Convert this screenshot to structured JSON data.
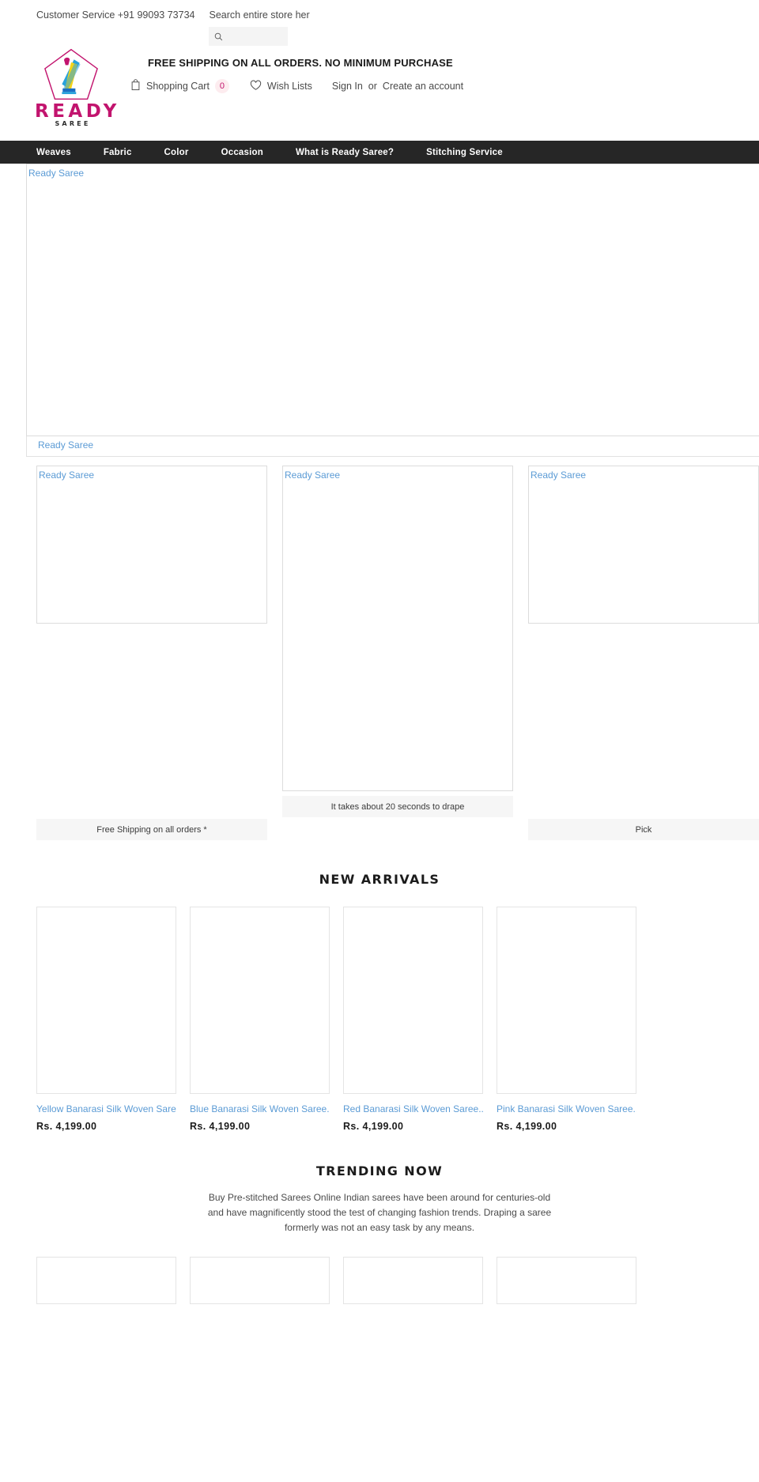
{
  "site": {
    "logo_word": "READY",
    "logo_sub": "SAREE",
    "logo_alt": "Ready Saree"
  },
  "topbar": {
    "customer_service": "Customer Service +91 99093 73734",
    "search_label": "Search entire store her",
    "search_value": "",
    "search_placeholder": ""
  },
  "promo": {
    "text": "FREE SHIPPING ON ALL ORDERS. NO MINIMUM PURCHASE"
  },
  "utility": {
    "cart_label": "Shopping Cart",
    "cart_count": "0",
    "wishlist_label": "Wish Lists",
    "signin_label": "Sign In",
    "or_label": " or ",
    "create_account_label": "Create an account"
  },
  "nav": {
    "items": [
      {
        "label": "Weaves"
      },
      {
        "label": "Fabric"
      },
      {
        "label": "Color"
      },
      {
        "label": "Occasion"
      },
      {
        "label": "What is Ready Saree?"
      },
      {
        "label": "Stitching Service"
      }
    ]
  },
  "hero": {
    "alt": "Ready Saree",
    "strip_alt": "Ready Saree"
  },
  "features": [
    {
      "alt": "Ready Saree",
      "caption": "Free Shipping on all orders *"
    },
    {
      "alt": "Ready Saree",
      "caption": "It takes about 20 seconds to drape"
    },
    {
      "alt": "Ready Saree",
      "caption": "Pick"
    }
  ],
  "new_arrivals": {
    "title": "NEW ARRIVALS",
    "products": [
      {
        "title": "Yellow Banarasi Silk Woven Saree...",
        "price": "Rs. 4,199.00"
      },
      {
        "title": "Blue Banarasi Silk Woven Saree...",
        "price": "Rs. 4,199.00"
      },
      {
        "title": "Red Banarasi Silk Woven Saree...",
        "price": "Rs. 4,199.00"
      },
      {
        "title": "Pink Banarasi Silk Woven Saree...",
        "price": "Rs. 4,199.00"
      }
    ]
  },
  "trending": {
    "title": "TRENDING NOW",
    "description": "Buy Pre-stitched Sarees Online Indian sarees have been around for centuries-old and have magnificently stood the test of changing fashion trends. Draping a saree formerly was not an easy task by any means."
  },
  "colors": {
    "brand_pink": "#c2146e",
    "nav_bg": "#262626",
    "link_blue": "#5b9bd5",
    "caption_bg": "#f6f6f6"
  }
}
